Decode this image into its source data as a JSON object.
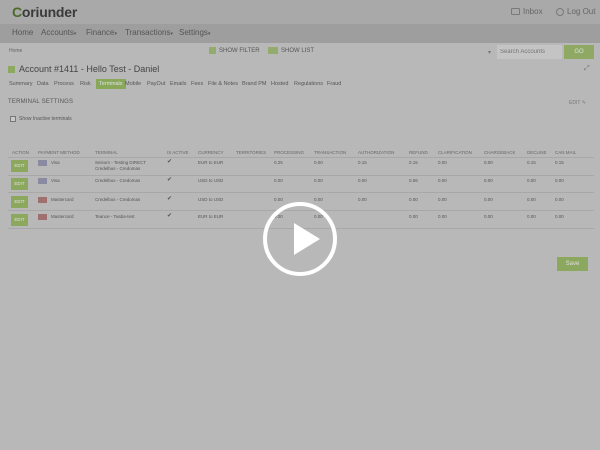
{
  "header": {
    "logo_letter": "C",
    "logo_rest": "oriunder",
    "inbox_label": "Inbox",
    "logout_label": "Log Out"
  },
  "nav": {
    "items": [
      "Home",
      "Accounts",
      "Finance",
      "Transactions",
      "Settings"
    ],
    "caret": "▾"
  },
  "filters": {
    "home_text": "Home",
    "show_filter": "SHOW FILTER",
    "show_list": "SHOW LIST",
    "dropdown_caret": "▾",
    "search_placeholder": "Search Accounts",
    "go_label": "GO"
  },
  "account": {
    "title": "Account #1411 - Hello Test - Daniel",
    "expand_icon": "⤢"
  },
  "tabs": [
    "Summary",
    "Data",
    "Process",
    "Risk",
    "Terminals",
    "Mobile",
    "PayOut",
    "Emails",
    "Fees",
    "File & Notes",
    "Brand PM",
    "Hosted",
    "Regulations",
    "Fraud"
  ],
  "active_tab": "Terminals",
  "section": {
    "title": "TERMINAL SETTINGS",
    "edit_label": "EDIT ✎",
    "checkbox_label": "Show Inactive terminals"
  },
  "table": {
    "headers": [
      "ACTION",
      "PAYMENT METHOD",
      "TERMINAL",
      "IS ACTIVE",
      "CURRENCY",
      "TERRITORIES",
      "PROCESSING",
      "TRANSACTION",
      "AUTHORIZATION",
      "REFUND",
      "CLARIFICATION",
      "CHARGEBACK",
      "DECLINE",
      "CAN MAIL"
    ],
    "edit_label": "EDIT",
    "rows": [
      {
        "method": "Visa",
        "terminal_line1": "Seisom - Testing DIRECT",
        "terminal_line2": "Credelbus - Credomas",
        "active": "✔",
        "currency": "EUR to EUR",
        "processing": "0.25",
        "transaction": "0.00",
        "authorization": "0.15",
        "refund": "0.15",
        "clarification": "0.00",
        "chargeback": "0.00",
        "decline": "0.15",
        "canmail": "0.15"
      },
      {
        "method": "Visa",
        "terminal_line1": "Credelbus - Credomas",
        "terminal_line2": "",
        "active": "✔",
        "currency": "USD to USD",
        "processing": "0.00",
        "transaction": "0.00",
        "authorization": "0.00",
        "refund": "0.06",
        "clarification": "0.00",
        "chargeback": "0.00",
        "decline": "0.00",
        "canmail": "0.00"
      },
      {
        "method": "Mastercard",
        "terminal_line1": "Credelbus - Credomas",
        "terminal_line2": "",
        "active": "✔",
        "currency": "USD to USD",
        "processing": "0.00",
        "transaction": "0.00",
        "authorization": "0.00",
        "refund": "0.00",
        "clarification": "0.00",
        "chargeback": "0.00",
        "decline": "0.00",
        "canmail": "0.00"
      },
      {
        "method": "Mastercard",
        "terminal_line1": "Teance - Teaba-test",
        "terminal_line2": "",
        "active": "✔",
        "currency": "EUR to EUR",
        "processing": "0.00",
        "transaction": "0.00",
        "authorization": "",
        "refund": "0.00",
        "clarification": "0.00",
        "chargeback": "0.00",
        "decline": "0.00",
        "canmail": "0.00"
      }
    ]
  },
  "save_label": "Save",
  "colors": {
    "accent": "#7aa23a",
    "overlay": "#b8b8b8"
  },
  "icons": {
    "play": "play-icon"
  }
}
